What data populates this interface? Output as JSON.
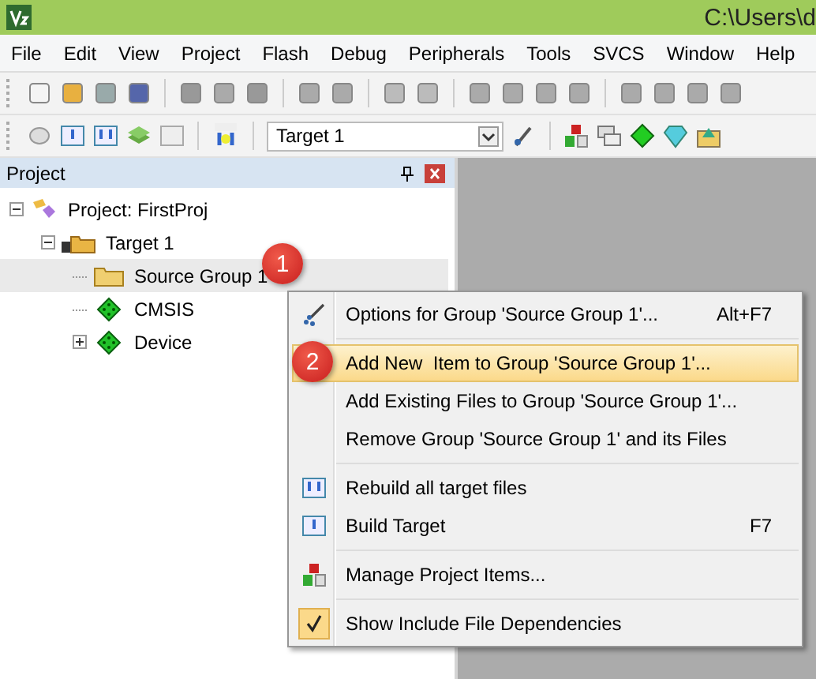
{
  "window": {
    "title": "C:\\Users\\d"
  },
  "menu_bar": [
    "File",
    "Edit",
    "View",
    "Project",
    "Flash",
    "Debug",
    "Peripherals",
    "Tools",
    "SVCS",
    "Window",
    "Help"
  ],
  "target_select": {
    "value": "Target 1"
  },
  "project_panel": {
    "title": "Project",
    "tree": [
      {
        "label": "Project: FirstProj",
        "expanded": true,
        "selected": false,
        "children": [
          {
            "label": "Target 1",
            "expanded": true,
            "selected": false,
            "children": [
              {
                "label": "Source Group 1",
                "selected": true
              },
              {
                "label": "CMSIS",
                "selected": false
              },
              {
                "label": "Device",
                "expanded": false,
                "selected": false
              }
            ]
          }
        ]
      }
    ]
  },
  "context_menu": {
    "items": [
      {
        "kind": "item",
        "label": "Options for Group 'Source Group 1'...",
        "shortcut": "Alt+F7",
        "selected": false,
        "checked": false
      },
      {
        "kind": "separator"
      },
      {
        "kind": "item",
        "label": "Add New  Item to Group 'Source Group 1'...",
        "selected": true,
        "checked": false
      },
      {
        "kind": "item",
        "label": "Add Existing Files to Group 'Source Group 1'...",
        "selected": false,
        "checked": false
      },
      {
        "kind": "item",
        "label": "Remove Group 'Source Group 1' and its Files",
        "selected": false,
        "checked": false
      },
      {
        "kind": "separator"
      },
      {
        "kind": "item",
        "label": "Rebuild all target files",
        "selected": false,
        "checked": false
      },
      {
        "kind": "item",
        "label": "Build Target",
        "shortcut": "F7",
        "selected": false,
        "checked": false
      },
      {
        "kind": "separator"
      },
      {
        "kind": "item",
        "label": "Manage Project Items...",
        "selected": false,
        "checked": false
      },
      {
        "kind": "separator"
      },
      {
        "kind": "item",
        "label": "Show Include File Dependencies",
        "selected": false,
        "checked": true
      }
    ]
  },
  "callouts": [
    "1",
    "2"
  ]
}
